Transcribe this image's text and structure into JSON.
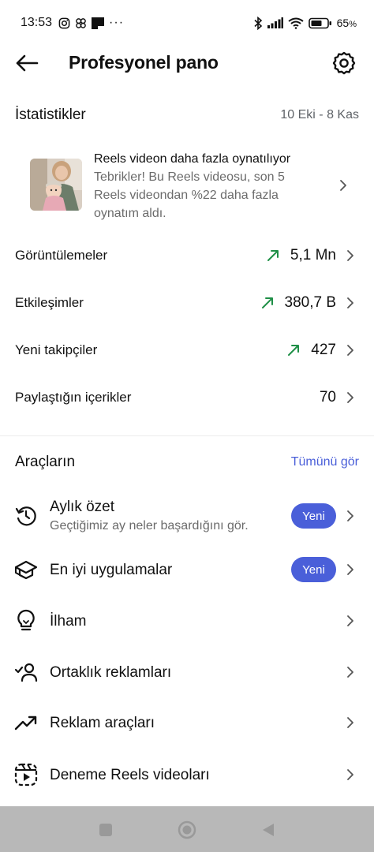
{
  "status_bar": {
    "time": "13:53",
    "battery": "65",
    "battery_unit": "%",
    "more": "···",
    "icons": [
      "instagram-icon",
      "threads-icon",
      "dark-square-icon",
      "bluetooth-icon",
      "signal-icon",
      "wifi-icon",
      "battery-icon"
    ]
  },
  "header": {
    "title": "Profesyonel pano",
    "back_icon": "arrow-left-icon",
    "settings_icon": "gear-icon"
  },
  "stats": {
    "title": "İstatistikler",
    "date_range": "10 Eki - 8 Kas",
    "reels_card": {
      "title": "Reels videon daha fazla oynatılıyor",
      "description_lines": [
        "Tebrikler! Bu Reels videosu, son 5",
        "Reels videondan %22 daha fazla",
        "oynatım aldı."
      ]
    },
    "rows": [
      {
        "label": "Görüntülemeler",
        "value": "5,1 Mn",
        "trend": "up"
      },
      {
        "label": "Etkileşimler",
        "value": "380,7 B",
        "trend": "up"
      },
      {
        "label": "Yeni takipçiler",
        "value": "427",
        "trend": "up"
      },
      {
        "label": "Paylaştığın içerikler",
        "value": "70",
        "trend": "none"
      }
    ],
    "trend_color": "#1f8f47"
  },
  "tools": {
    "title": "Araçların",
    "see_all": "Tümünü gör",
    "items": [
      {
        "label": "Aylık özet",
        "subtitle": "Geçtiğimiz ay neler başardığını gör.",
        "badge": "Yeni",
        "icon": "history-clock-icon"
      },
      {
        "label": "En iyi uygulamalar",
        "badge": "Yeni",
        "icon": "graduation-cap-icon"
      },
      {
        "label": "İlham",
        "icon": "lightbulb-icon"
      },
      {
        "label": "Ortaklık reklamları",
        "icon": "partnership-person-check-icon"
      },
      {
        "label": "Reklam araçları",
        "icon": "trending-up-icon"
      },
      {
        "label": "Deneme Reels videoları",
        "icon": "reels-trial-icon"
      }
    ]
  },
  "colors": {
    "accent": "#4a5fd9",
    "trend_up": "#1f8f47",
    "nav_bar": "#b8b8b8"
  },
  "nav": {
    "buttons": [
      "recents-square-icon",
      "home-circle-icon",
      "back-triangle-icon"
    ]
  }
}
